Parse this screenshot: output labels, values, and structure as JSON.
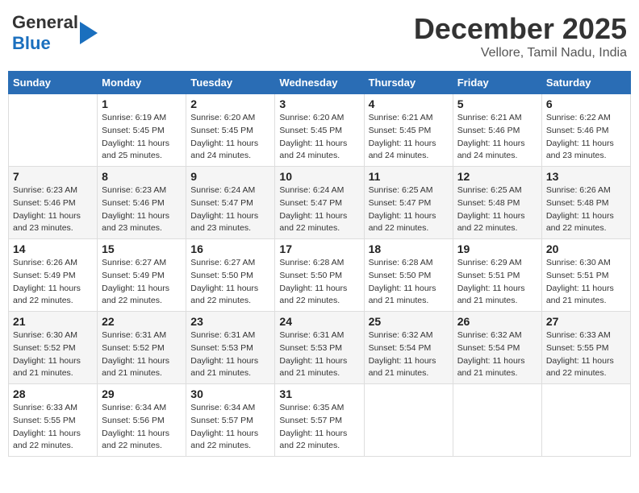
{
  "header": {
    "logo_general": "General",
    "logo_blue": "Blue",
    "month_title": "December 2025",
    "subtitle": "Vellore, Tamil Nadu, India"
  },
  "days_of_week": [
    "Sunday",
    "Monday",
    "Tuesday",
    "Wednesday",
    "Thursday",
    "Friday",
    "Saturday"
  ],
  "weeks": [
    [
      {
        "day": "",
        "text": ""
      },
      {
        "day": "1",
        "text": "Sunrise: 6:19 AM\nSunset: 5:45 PM\nDaylight: 11 hours\nand 25 minutes."
      },
      {
        "day": "2",
        "text": "Sunrise: 6:20 AM\nSunset: 5:45 PM\nDaylight: 11 hours\nand 24 minutes."
      },
      {
        "day": "3",
        "text": "Sunrise: 6:20 AM\nSunset: 5:45 PM\nDaylight: 11 hours\nand 24 minutes."
      },
      {
        "day": "4",
        "text": "Sunrise: 6:21 AM\nSunset: 5:45 PM\nDaylight: 11 hours\nand 24 minutes."
      },
      {
        "day": "5",
        "text": "Sunrise: 6:21 AM\nSunset: 5:46 PM\nDaylight: 11 hours\nand 24 minutes."
      },
      {
        "day": "6",
        "text": "Sunrise: 6:22 AM\nSunset: 5:46 PM\nDaylight: 11 hours\nand 23 minutes."
      }
    ],
    [
      {
        "day": "7",
        "text": "Sunrise: 6:23 AM\nSunset: 5:46 PM\nDaylight: 11 hours\nand 23 minutes."
      },
      {
        "day": "8",
        "text": "Sunrise: 6:23 AM\nSunset: 5:46 PM\nDaylight: 11 hours\nand 23 minutes."
      },
      {
        "day": "9",
        "text": "Sunrise: 6:24 AM\nSunset: 5:47 PM\nDaylight: 11 hours\nand 23 minutes."
      },
      {
        "day": "10",
        "text": "Sunrise: 6:24 AM\nSunset: 5:47 PM\nDaylight: 11 hours\nand 22 minutes."
      },
      {
        "day": "11",
        "text": "Sunrise: 6:25 AM\nSunset: 5:47 PM\nDaylight: 11 hours\nand 22 minutes."
      },
      {
        "day": "12",
        "text": "Sunrise: 6:25 AM\nSunset: 5:48 PM\nDaylight: 11 hours\nand 22 minutes."
      },
      {
        "day": "13",
        "text": "Sunrise: 6:26 AM\nSunset: 5:48 PM\nDaylight: 11 hours\nand 22 minutes."
      }
    ],
    [
      {
        "day": "14",
        "text": "Sunrise: 6:26 AM\nSunset: 5:49 PM\nDaylight: 11 hours\nand 22 minutes."
      },
      {
        "day": "15",
        "text": "Sunrise: 6:27 AM\nSunset: 5:49 PM\nDaylight: 11 hours\nand 22 minutes."
      },
      {
        "day": "16",
        "text": "Sunrise: 6:27 AM\nSunset: 5:50 PM\nDaylight: 11 hours\nand 22 minutes."
      },
      {
        "day": "17",
        "text": "Sunrise: 6:28 AM\nSunset: 5:50 PM\nDaylight: 11 hours\nand 22 minutes."
      },
      {
        "day": "18",
        "text": "Sunrise: 6:28 AM\nSunset: 5:50 PM\nDaylight: 11 hours\nand 21 minutes."
      },
      {
        "day": "19",
        "text": "Sunrise: 6:29 AM\nSunset: 5:51 PM\nDaylight: 11 hours\nand 21 minutes."
      },
      {
        "day": "20",
        "text": "Sunrise: 6:30 AM\nSunset: 5:51 PM\nDaylight: 11 hours\nand 21 minutes."
      }
    ],
    [
      {
        "day": "21",
        "text": "Sunrise: 6:30 AM\nSunset: 5:52 PM\nDaylight: 11 hours\nand 21 minutes."
      },
      {
        "day": "22",
        "text": "Sunrise: 6:31 AM\nSunset: 5:52 PM\nDaylight: 11 hours\nand 21 minutes."
      },
      {
        "day": "23",
        "text": "Sunrise: 6:31 AM\nSunset: 5:53 PM\nDaylight: 11 hours\nand 21 minutes."
      },
      {
        "day": "24",
        "text": "Sunrise: 6:31 AM\nSunset: 5:53 PM\nDaylight: 11 hours\nand 21 minutes."
      },
      {
        "day": "25",
        "text": "Sunrise: 6:32 AM\nSunset: 5:54 PM\nDaylight: 11 hours\nand 21 minutes."
      },
      {
        "day": "26",
        "text": "Sunrise: 6:32 AM\nSunset: 5:54 PM\nDaylight: 11 hours\nand 21 minutes."
      },
      {
        "day": "27",
        "text": "Sunrise: 6:33 AM\nSunset: 5:55 PM\nDaylight: 11 hours\nand 22 minutes."
      }
    ],
    [
      {
        "day": "28",
        "text": "Sunrise: 6:33 AM\nSunset: 5:55 PM\nDaylight: 11 hours\nand 22 minutes."
      },
      {
        "day": "29",
        "text": "Sunrise: 6:34 AM\nSunset: 5:56 PM\nDaylight: 11 hours\nand 22 minutes."
      },
      {
        "day": "30",
        "text": "Sunrise: 6:34 AM\nSunset: 5:57 PM\nDaylight: 11 hours\nand 22 minutes."
      },
      {
        "day": "31",
        "text": "Sunrise: 6:35 AM\nSunset: 5:57 PM\nDaylight: 11 hours\nand 22 minutes."
      },
      {
        "day": "",
        "text": ""
      },
      {
        "day": "",
        "text": ""
      },
      {
        "day": "",
        "text": ""
      }
    ]
  ]
}
